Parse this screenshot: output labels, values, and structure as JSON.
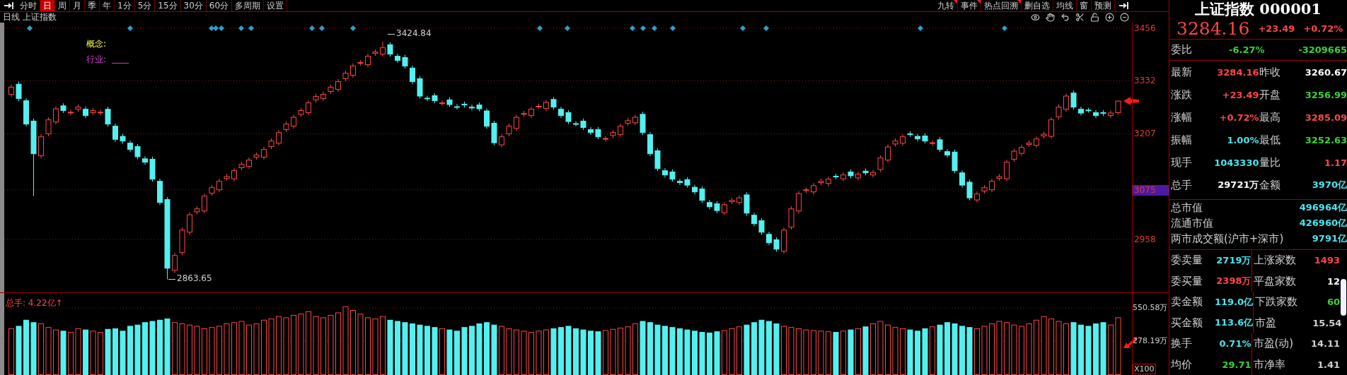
{
  "toolbar": {
    "left": [
      {
        "label": "分时",
        "selected": false
      },
      {
        "label": "日",
        "selected": true
      },
      {
        "label": "周",
        "selected": false
      },
      {
        "label": "月",
        "selected": false
      },
      {
        "label": "季",
        "selected": false
      },
      {
        "label": "年",
        "selected": false
      },
      {
        "label": "1分",
        "selected": false
      },
      {
        "label": "5分",
        "selected": false
      },
      {
        "label": "15分",
        "selected": false
      },
      {
        "label": "30分",
        "selected": false
      },
      {
        "label": "60分",
        "selected": false
      },
      {
        "label": "多周期",
        "selected": false
      },
      {
        "label": "设置",
        "selected": false
      }
    ],
    "right": [
      {
        "label": "九转",
        "flagged": true
      },
      {
        "label": "事件",
        "flagged": true
      },
      {
        "label": "热点回溯",
        "flagged": true
      },
      {
        "label": "删自选",
        "flagged": false
      },
      {
        "label": "均线",
        "flagged": false
      },
      {
        "label": "窗",
        "flagged": false
      },
      {
        "label": "预测",
        "flagged": false
      }
    ]
  },
  "chart_header": {
    "period": "日线",
    "name": "上证指数"
  },
  "info": {
    "concept_label": "概念:",
    "industry_label": "行业:",
    "industry_value": "____"
  },
  "annotations": {
    "high": "3424.84",
    "low": "2863.65"
  },
  "price_chart": {
    "tick_states": [
      {
        "highlighted": false
      },
      {
        "highlighted": false
      },
      {
        "highlighted": false
      },
      {
        "highlighted": true
      },
      {
        "highlighted": false
      }
    ],
    "chart_data": {
      "type": "candlestick",
      "grid": true,
      "ylim": [
        2834.7,
        3469.3
      ],
      "yticks": [
        {
          "value": 3456,
          "label": "3456"
        },
        {
          "value": 3332,
          "label": "3332"
        },
        {
          "value": 3207,
          "label": "3207"
        },
        {
          "value": 3075,
          "label": "3075"
        },
        {
          "value": 2958,
          "label": "2958"
        }
      ],
      "ohlc": [
        [
          3300,
          3323,
          3294,
          3317
        ],
        [
          3324,
          3330,
          3284,
          3290
        ],
        [
          3285,
          3291,
          3224,
          3230
        ],
        [
          3237,
          3243,
          3060,
          3160
        ],
        [
          3155,
          3206,
          3149,
          3200
        ],
        [
          3207,
          3246,
          3201,
          3240
        ],
        [
          3235,
          3272,
          3229,
          3266
        ],
        [
          3273,
          3279,
          3256,
          3262
        ],
        [
          3257,
          3264,
          3251,
          3258
        ],
        [
          3265,
          3276,
          3259,
          3270
        ],
        [
          3265,
          3271,
          3244,
          3250
        ],
        [
          3257,
          3268,
          3251,
          3262
        ],
        [
          3257,
          3264,
          3251,
          3258
        ],
        [
          3265,
          3271,
          3224,
          3230
        ],
        [
          3225,
          3231,
          3188,
          3194
        ],
        [
          3201,
          3207,
          3184,
          3190
        ],
        [
          3185,
          3191,
          3164,
          3170
        ],
        [
          3177,
          3183,
          3147,
          3153
        ],
        [
          3148,
          3154,
          3134,
          3140
        ],
        [
          3147,
          3153,
          3094,
          3100
        ],
        [
          3095,
          3101,
          3039,
          3045
        ],
        [
          3052,
          3058,
          2863.65,
          2890
        ],
        [
          2885,
          2926,
          2879,
          2920
        ],
        [
          2927,
          2986,
          2921,
          2980
        ],
        [
          2975,
          3022,
          2969,
          3016
        ],
        [
          3023,
          3036,
          3017,
          3030
        ],
        [
          3025,
          3066,
          3019,
          3060
        ],
        [
          3067,
          3086,
          3061,
          3080
        ],
        [
          3075,
          3101,
          3069,
          3095
        ],
        [
          3102,
          3112,
          3096,
          3106
        ],
        [
          3101,
          3126,
          3095,
          3120
        ],
        [
          3127,
          3141,
          3121,
          3135
        ],
        [
          3130,
          3151,
          3124,
          3145
        ],
        [
          3152,
          3163,
          3146,
          3157
        ],
        [
          3152,
          3176,
          3146,
          3170
        ],
        [
          3177,
          3196,
          3171,
          3190
        ],
        [
          3185,
          3216,
          3179,
          3210
        ],
        [
          3217,
          3236,
          3211,
          3230
        ],
        [
          3225,
          3252,
          3219,
          3246
        ],
        [
          3253,
          3268,
          3247,
          3262
        ],
        [
          3257,
          3286,
          3251,
          3280
        ],
        [
          3287,
          3301,
          3281,
          3295
        ],
        [
          3290,
          3306,
          3284,
          3300
        ],
        [
          3307,
          3323,
          3301,
          3317
        ],
        [
          3312,
          3336,
          3306,
          3330
        ],
        [
          3337,
          3356,
          3331,
          3350
        ],
        [
          3345,
          3373,
          3339,
          3367
        ],
        [
          3374,
          3381,
          3368,
          3375
        ],
        [
          3370,
          3396,
          3364,
          3390
        ],
        [
          3397,
          3406,
          3391,
          3400
        ],
        [
          3395,
          3424.84,
          3389,
          3410
        ],
        [
          3417,
          3423,
          3389,
          3395
        ],
        [
          3390,
          3396,
          3374,
          3380
        ],
        [
          3387,
          3393,
          3361,
          3367
        ],
        [
          3362,
          3368,
          3324,
          3330
        ],
        [
          3337,
          3343,
          3290,
          3296
        ],
        [
          3291,
          3297,
          3284,
          3290
        ],
        [
          3297,
          3303,
          3279,
          3285
        ],
        [
          3280,
          3286,
          3274,
          3280
        ],
        [
          3287,
          3293,
          3270,
          3276
        ],
        [
          3271,
          3277,
          3264,
          3270
        ],
        [
          3277,
          3283,
          3269,
          3275
        ],
        [
          3270,
          3276,
          3262,
          3268
        ],
        [
          3275,
          3281,
          3260,
          3266
        ],
        [
          3261,
          3267,
          3219,
          3225
        ],
        [
          3232,
          3238,
          3180,
          3186
        ],
        [
          3181,
          3206,
          3175,
          3200
        ],
        [
          3207,
          3231,
          3201,
          3225
        ],
        [
          3220,
          3252,
          3214,
          3246
        ],
        [
          3253,
          3261,
          3247,
          3255
        ],
        [
          3250,
          3271,
          3244,
          3265
        ],
        [
          3272,
          3278,
          3266,
          3272
        ],
        [
          3267,
          3287,
          3261,
          3281
        ],
        [
          3288,
          3294,
          3264,
          3270
        ],
        [
          3265,
          3271,
          3244,
          3250
        ],
        [
          3257,
          3263,
          3230,
          3236
        ],
        [
          3231,
          3237,
          3225,
          3230
        ],
        [
          3237,
          3243,
          3216,
          3222
        ],
        [
          3217,
          3223,
          3204,
          3210
        ],
        [
          3217,
          3223,
          3194,
          3200
        ],
        [
          3195,
          3202,
          3189,
          3196
        ],
        [
          3203,
          3216,
          3197,
          3210
        ],
        [
          3205,
          3231,
          3199,
          3225
        ],
        [
          3232,
          3244,
          3226,
          3238
        ],
        [
          3233,
          3252,
          3227,
          3246
        ],
        [
          3253,
          3259,
          3204,
          3210
        ],
        [
          3205,
          3211,
          3154,
          3160
        ],
        [
          3167,
          3173,
          3119,
          3125
        ],
        [
          3120,
          3126,
          3104,
          3110
        ],
        [
          3117,
          3123,
          3094,
          3100
        ],
        [
          3095,
          3101,
          3086,
          3092
        ],
        [
          3099,
          3105,
          3080,
          3086
        ],
        [
          3081,
          3087,
          3064,
          3070
        ],
        [
          3077,
          3083,
          3044,
          3050
        ],
        [
          3045,
          3051,
          3029,
          3035
        ],
        [
          3042,
          3048,
          3020,
          3026
        ],
        [
          3021,
          3046,
          3015,
          3040
        ],
        [
          3047,
          3056,
          3041,
          3050
        ],
        [
          3045,
          3062,
          3039,
          3056
        ],
        [
          3063,
          3069,
          3014,
          3020
        ],
        [
          3015,
          3021,
          2989,
          2995
        ],
        [
          3002,
          3008,
          2969,
          2975
        ],
        [
          2970,
          2976,
          2944,
          2950
        ],
        [
          2957,
          2963,
          2929,
          2935
        ],
        [
          2930,
          2986,
          2924,
          2980
        ],
        [
          2987,
          3036,
          2981,
          3030
        ],
        [
          3025,
          3072,
          3019,
          3066
        ],
        [
          3073,
          3081,
          3067,
          3075
        ],
        [
          3070,
          3091,
          3064,
          3085
        ],
        [
          3092,
          3101,
          3086,
          3095
        ],
        [
          3090,
          3106,
          3084,
          3100
        ],
        [
          3107,
          3113,
          3100,
          3106
        ],
        [
          3101,
          3116,
          3095,
          3110
        ],
        [
          3117,
          3123,
          3102,
          3108
        ],
        [
          3103,
          3118,
          3097,
          3112
        ],
        [
          3119,
          3125,
          3109,
          3115
        ],
        [
          3110,
          3122,
          3104,
          3116
        ],
        [
          3123,
          3156,
          3117,
          3150
        ],
        [
          3145,
          3182,
          3139,
          3176
        ],
        [
          3183,
          3196,
          3177,
          3190
        ],
        [
          3185,
          3206,
          3179,
          3200
        ],
        [
          3207,
          3213,
          3200,
          3206
        ],
        [
          3201,
          3207,
          3189,
          3195
        ],
        [
          3202,
          3208,
          3184,
          3190
        ],
        [
          3185,
          3192,
          3179,
          3186
        ],
        [
          3193,
          3199,
          3164,
          3170
        ],
        [
          3165,
          3171,
          3151,
          3157
        ],
        [
          3164,
          3170,
          3114,
          3120
        ],
        [
          3115,
          3121,
          3080,
          3086
        ],
        [
          3093,
          3099,
          3050,
          3056
        ],
        [
          3051,
          3071,
          3045,
          3065
        ],
        [
          3072,
          3086,
          3066,
          3080
        ],
        [
          3075,
          3101,
          3069,
          3095
        ],
        [
          3102,
          3112,
          3096,
          3106
        ],
        [
          3101,
          3146,
          3095,
          3140
        ],
        [
          3147,
          3172,
          3141,
          3166
        ],
        [
          3161,
          3181,
          3155,
          3175
        ],
        [
          3182,
          3191,
          3176,
          3185
        ],
        [
          3180,
          3201,
          3174,
          3195
        ],
        [
          3202,
          3212,
          3196,
          3206
        ],
        [
          3201,
          3246,
          3195,
          3240
        ],
        [
          3247,
          3276,
          3241,
          3270
        ],
        [
          3265,
          3302,
          3259,
          3296
        ],
        [
          3303,
          3309,
          3264,
          3270
        ],
        [
          3265,
          3271,
          3250,
          3256
        ],
        [
          3263,
          3268,
          3257,
          3262
        ],
        [
          3257,
          3263,
          3244,
          3250
        ],
        [
          3257,
          3263,
          3249,
          3255
        ],
        [
          3250,
          3262,
          3244,
          3256
        ],
        [
          3256.99,
          3285.09,
          3252.63,
          3284.16
        ]
      ]
    }
  },
  "volume": {
    "label": "总手: 4.22亿↑",
    "scale": "X100",
    "chart_data": {
      "type": "bar",
      "grid": true,
      "ylim": [
        0,
        672
      ],
      "yticks": [
        {
          "value": 550.58,
          "label": "550.58万"
        },
        {
          "value": 278.19,
          "label": "278.19万"
        }
      ],
      "values": [
        380,
        400,
        450,
        430,
        420,
        390,
        370,
        360,
        350,
        380,
        370,
        360,
        350,
        375,
        380,
        360,
        400,
        410,
        430,
        440,
        450,
        460,
        430,
        420,
        410,
        400,
        380,
        390,
        400,
        420,
        430,
        440,
        410,
        420,
        450,
        460,
        480,
        470,
        490,
        500,
        520,
        480,
        470,
        490,
        510,
        560,
        530,
        500,
        470,
        460,
        480,
        450,
        440,
        430,
        420,
        410,
        400,
        390,
        380,
        370,
        360,
        390,
        400,
        420,
        430,
        410,
        400,
        380,
        370,
        360,
        350,
        360,
        370,
        380,
        390,
        400,
        380,
        370,
        360,
        355,
        365,
        375,
        385,
        395,
        420,
        440,
        430,
        410,
        400,
        390,
        380,
        370,
        360,
        350,
        345,
        355,
        365,
        380,
        395,
        410,
        430,
        450,
        440,
        420,
        400,
        390,
        380,
        370,
        365,
        360,
        355,
        350,
        360,
        370,
        380,
        395,
        420,
        440,
        410,
        390,
        380,
        370,
        360,
        380,
        395,
        410,
        430,
        420,
        400,
        390,
        380,
        400,
        420,
        440,
        430,
        410,
        400,
        420,
        450,
        480,
        460,
        440,
        420,
        430,
        410,
        400,
        420,
        430,
        410,
        470
      ]
    }
  },
  "quote": {
    "title": "上证指数 000001",
    "price": "3284.16",
    "change": "+23.49",
    "change_pct": "+0.72%",
    "color": "#ff4646",
    "weibi": {
      "label": "委比",
      "pct": "-6.27%",
      "value": "-3209665",
      "color": "#3ad23a"
    },
    "rows": [
      [
        {
          "label": "最新",
          "value": "3284.16",
          "color": "#ff4646"
        },
        {
          "label": "昨收",
          "value": "3260.67",
          "color": "#ffffff"
        }
      ],
      [
        {
          "label": "涨跌",
          "value": "+23.49",
          "color": "#ff4646"
        },
        {
          "label": "开盘",
          "value": "3256.99",
          "color": "#3ad23a"
        }
      ],
      [
        {
          "label": "涨幅",
          "value": "+0.72%",
          "color": "#ff4646"
        },
        {
          "label": "最高",
          "value": "3285.09",
          "color": "#ff4646"
        }
      ],
      [
        {
          "label": "振幅",
          "value": "1.00%",
          "color": "#4ae6f0"
        },
        {
          "label": "最低",
          "value": "3252.63",
          "color": "#3ad23a"
        }
      ],
      [
        {
          "label": "现手",
          "value": "1043330",
          "color": "#4ae6f0"
        },
        {
          "label": "量比",
          "value": "1.17",
          "color": "#ff4646"
        }
      ],
      [
        {
          "label": "总手",
          "value": "29721万",
          "color": "#ffffff"
        },
        {
          "label": "金额",
          "value": "3970亿",
          "color": "#4ae6f0"
        }
      ]
    ],
    "market": [
      {
        "label": "总市值",
        "value": "496964亿",
        "color": "#4ae6f0"
      },
      {
        "label": "流通市值",
        "value": "426960亿",
        "color": "#4ae6f0"
      },
      {
        "label": "两市成交额(沪市+深市)",
        "value": "9791亿",
        "color": "#4ae6f0"
      }
    ],
    "stats": [
      [
        {
          "label": "委卖量",
          "value": "2719万",
          "color": "#4ae6f0"
        },
        {
          "label": "上涨家数",
          "value": "1493",
          "color": "#ff4646"
        }
      ],
      [
        {
          "label": "委买量",
          "value": "2398万",
          "color": "#ff4646"
        },
        {
          "label": "平盘家数",
          "value": "12",
          "color": "#ffffff"
        }
      ],
      [
        {
          "label": "卖金额",
          "value": "119.0亿",
          "color": "#4ae6f0"
        },
        {
          "label": "下跌家数",
          "value": "60",
          "color": "#3ad23a"
        }
      ],
      [
        {
          "label": "买金额",
          "value": "113.6亿",
          "color": "#4ae6f0"
        },
        {
          "label": "市盈",
          "value": "15.54",
          "color": "#d0d0d0"
        }
      ],
      [
        {
          "label": "换手",
          "value": "0.71%",
          "color": "#4ae6f0"
        },
        {
          "label": "市盈(动)",
          "value": "14.11",
          "color": "#d0d0d0"
        }
      ],
      [
        {
          "label": "均价",
          "value": "29.71",
          "color": "#3ad23a"
        },
        {
          "label": "市净率",
          "value": "1.41",
          "color": "#d0d0d0"
        }
      ]
    ]
  }
}
